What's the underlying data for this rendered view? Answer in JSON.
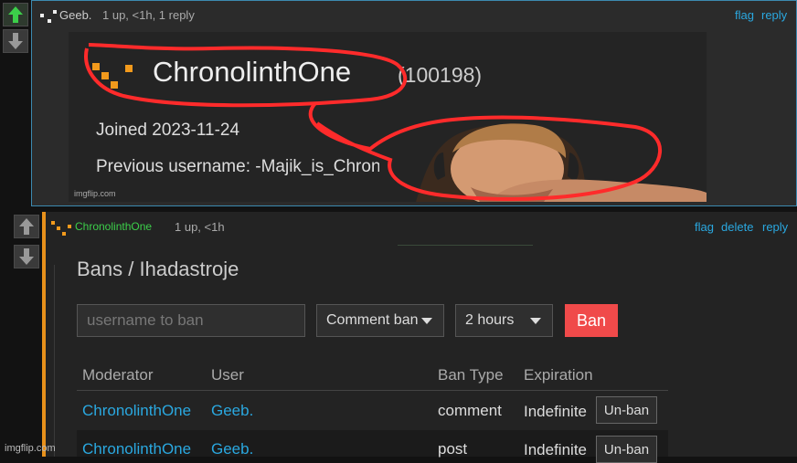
{
  "top_comment": {
    "author": "Geeb.",
    "meta": "1 up, <1h, 1 reply",
    "actions": [
      "flag",
      "reply"
    ],
    "embedded": {
      "username": "ChronolinthOne",
      "points": "(100198)",
      "joined": "Joined 2023-11-24",
      "previous": "Previous username: -Majik_is_Chron",
      "watermark": "imgflip.com"
    }
  },
  "reply_comment": {
    "author": "ChronolinthOne",
    "meta": "1 up, <1h",
    "actions": [
      "flag",
      "delete",
      "reply"
    ],
    "panel": {
      "title": "Bans / Ihadastroje",
      "username_placeholder": "username to ban",
      "ban_type": "Comment ban",
      "duration": "2 hours",
      "ban_button": "Ban",
      "columns": [
        "Moderator",
        "User",
        "Ban Type",
        "Expiration"
      ],
      "rows": [
        {
          "moderator": "ChronolinthOne",
          "user": "Geeb.",
          "type": "comment",
          "expiration": "Indefinite",
          "action": "Un-ban"
        },
        {
          "moderator": "ChronolinthOne",
          "user": "Geeb.",
          "type": "post",
          "expiration": "Indefinite",
          "action": "Un-ban"
        }
      ]
    }
  },
  "watermark": "imgflip.com",
  "colors": {
    "accent": "#2aa8e0",
    "upvote": "#3ccf4a",
    "ban": "#f04a4a",
    "thread": "#e8911b",
    "highlight": "#ff2b2b"
  }
}
